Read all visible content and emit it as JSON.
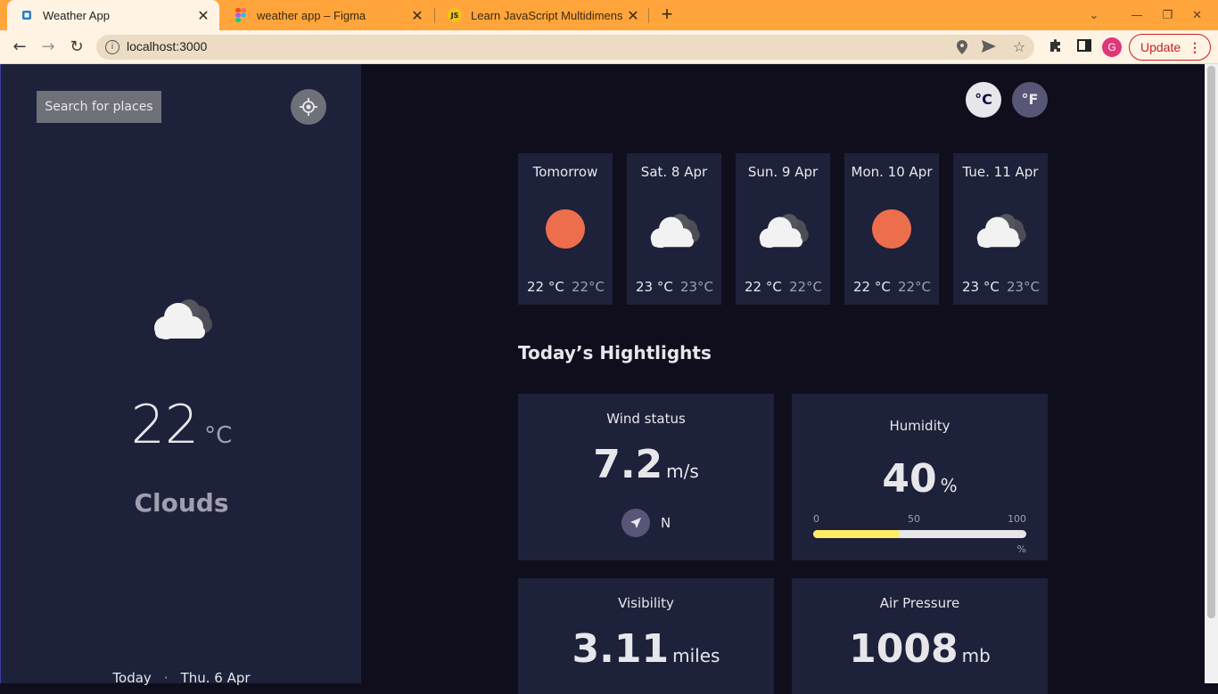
{
  "browser": {
    "tabs": [
      {
        "title": "Weather App",
        "favicon": "weather-app-favicon",
        "active": true
      },
      {
        "title": "weather app – Figma",
        "favicon": "figma-favicon",
        "active": false
      },
      {
        "title": "Learn JavaScript Multidimens",
        "favicon": "js-favicon",
        "favicon_text": "JS",
        "active": false
      }
    ],
    "url": "localhost:3000",
    "profile_initial": "G",
    "update_label": "Update"
  },
  "sidebar": {
    "search_label": "Search for places",
    "icon": "cloud-icon",
    "temperature": "22",
    "temp_unit": "°C",
    "condition": "Clouds",
    "today_label": "Today",
    "separator": "·",
    "date": "Thu. 6 Apr"
  },
  "units": {
    "celsius": "°C",
    "fahrenheit": "°F"
  },
  "forecast": [
    {
      "day": "Tomorrow",
      "icon": "sun-icon",
      "max": "22 °C",
      "min": "22°C"
    },
    {
      "day": "Sat. 8 Apr",
      "icon": "cloud-icon",
      "max": "23 °C",
      "min": "23°C"
    },
    {
      "day": "Sun. 9 Apr",
      "icon": "cloud-icon",
      "max": "22 °C",
      "min": "22°C"
    },
    {
      "day": "Mon. 10 Apr",
      "icon": "sun-icon",
      "max": "22 °C",
      "min": "22°C"
    },
    {
      "day": "Tue. 11 Apr",
      "icon": "cloud-icon",
      "max": "23 °C",
      "min": "23°C"
    }
  ],
  "highlights": {
    "title": "Today’s Hightlights",
    "wind": {
      "label": "Wind status",
      "value": "7.2",
      "unit": "m/s",
      "direction": "N"
    },
    "humidity": {
      "label": "Humidity",
      "value": "40",
      "unit": "%",
      "scale_min": "0",
      "scale_mid": "50",
      "scale_max": "100",
      "scale_unit": "%",
      "level": 0.4
    },
    "visibility": {
      "label": "Visibility",
      "value": "3.11",
      "unit": "miles"
    },
    "pressure": {
      "label": "Air Pressure",
      "value": "1008",
      "unit": "mb"
    }
  },
  "colors": {
    "accent_bar": "#ffec65",
    "sun": "#ed6e4d",
    "sidebar_bg": "#1e213a",
    "page_bg": "#100e1d",
    "tab_strip": "#ffa53c"
  }
}
